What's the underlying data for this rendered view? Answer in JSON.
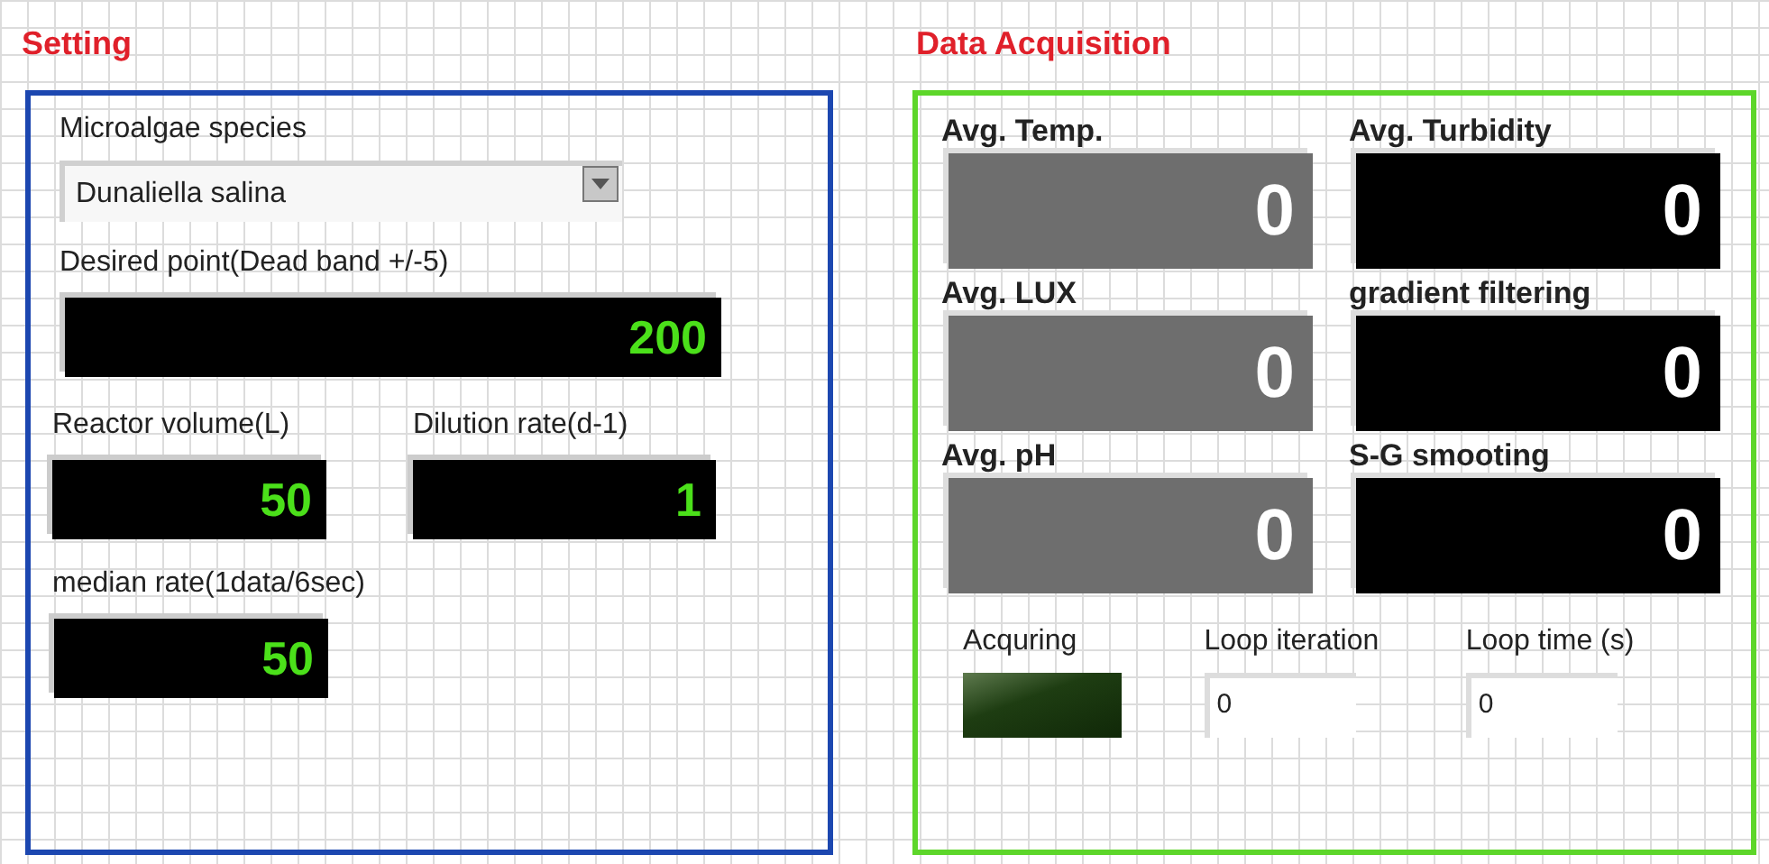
{
  "setting": {
    "title": "Setting",
    "species": {
      "label": "Microalgae species",
      "value": "Dunaliella salina"
    },
    "desired": {
      "label": "Desired point(Dead band +/-5)",
      "value": "200"
    },
    "pair": [
      {
        "label": "Reactor volume(L)",
        "value": "50"
      },
      {
        "label": "Dilution rate(d-1)",
        "value": "1"
      }
    ],
    "median": {
      "label": "median rate(1data/6sec)",
      "value": "50"
    }
  },
  "acquisition": {
    "title": "Data Acquisition",
    "indicators": [
      {
        "label": "Avg. Temp.",
        "value": "0",
        "disabled": true
      },
      {
        "label": "Avg. Turbidity",
        "value": "0",
        "disabled": false
      },
      {
        "label": "Avg. LUX",
        "value": "0",
        "disabled": true
      },
      {
        "label": "gradient filtering",
        "value": "0",
        "disabled": false
      },
      {
        "label": "Avg. pH",
        "value": "0",
        "disabled": true
      },
      {
        "label": "S-G smooting",
        "value": "0",
        "disabled": false
      }
    ],
    "led": {
      "label": "Acquring",
      "on": false
    },
    "counters": [
      {
        "label": "Loop iteration",
        "value": "0"
      },
      {
        "label": "Loop time (s)",
        "value": "0"
      }
    ]
  }
}
